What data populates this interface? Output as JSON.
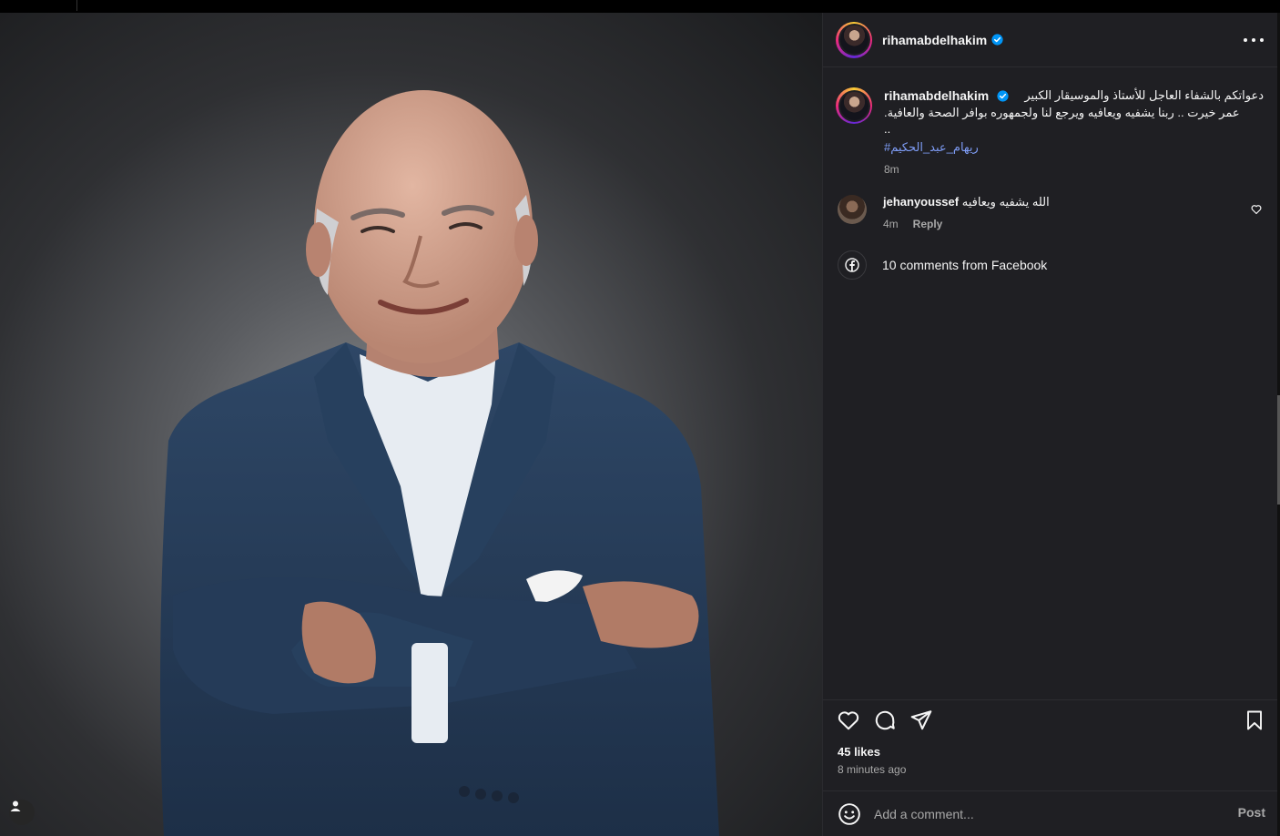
{
  "post": {
    "author": "rihamabdelhakim",
    "caption_line1": "دعواتكم بالشفاء العاجل للأستاذ والموسيقار الكبير",
    "caption_line2": "عمر خيرت .. ربنا يشفيه ويعافيه ويرجع لنا ولجمهوره بوافر الصحة والعافية.",
    "caption_line3": "..",
    "hashtag": "#ريهام_عبد_الحكيم",
    "caption_time": "8m",
    "likes": "45 likes",
    "time_ago": "8 minutes ago",
    "photo_alt": ""
  },
  "comments": [
    {
      "username": "jehanyoussef",
      "text": "الله يشفيه ويعافيه",
      "time": "4m",
      "reply_label": "Reply"
    }
  ],
  "facebook_comments": "10 comments from Facebook",
  "add_comment": {
    "placeholder": "Add a comment...",
    "post_label": "Post"
  },
  "icons": {
    "more": "more-icon",
    "verified": "verified-badge-icon",
    "like": "heart-icon",
    "comment": "comment-icon",
    "share": "send-icon",
    "save": "bookmark-icon",
    "emoji": "emoji-icon",
    "facebook": "facebook-icon",
    "tagged_user": "person-icon"
  },
  "colors": {
    "panel_bg": "#1f1f23",
    "hashtag": "#7e9cf5",
    "verified": "#0095f6",
    "muted_text": "#a8a8a8"
  }
}
